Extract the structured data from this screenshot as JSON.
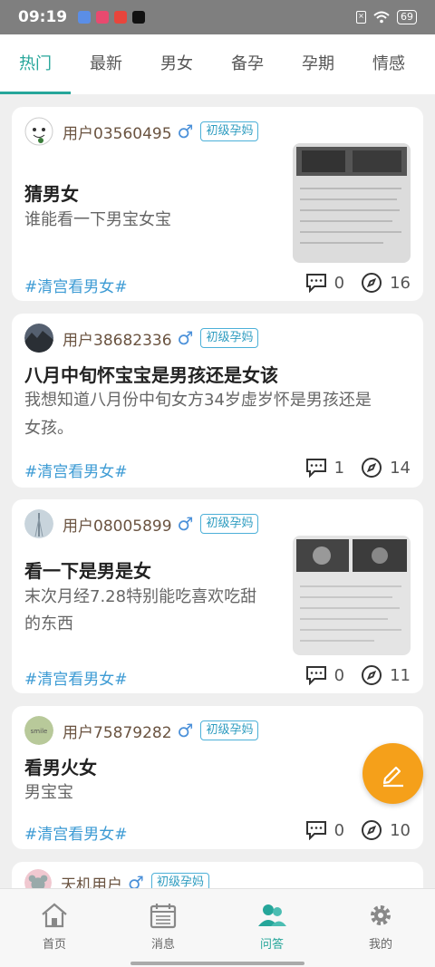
{
  "status_bar": {
    "time": "09:19",
    "battery": "69"
  },
  "tabs": [
    {
      "label": "热门",
      "active": true
    },
    {
      "label": "最新"
    },
    {
      "label": "男女"
    },
    {
      "label": "备孕"
    },
    {
      "label": "孕期"
    },
    {
      "label": "情感"
    }
  ],
  "posts": [
    {
      "user": "用户03560495",
      "gender": "♂",
      "level": "初级孕妈",
      "title": "猜男女",
      "desc": "谁能看一下男宝女宝",
      "tag": "#清宫看男女#",
      "comments": "0",
      "views": "16"
    },
    {
      "user": "用户38682336",
      "gender": "♂",
      "level": "初级孕妈",
      "title": "八月中旬怀宝宝是男孩还是女该",
      "desc_line1": "我想知道八月份中旬女方34岁虚岁怀是男孩还是",
      "desc_line2": "女孩。",
      "tag": "#清宫看男女#",
      "comments": "1",
      "views": "14"
    },
    {
      "user": "用户08005899",
      "gender": "♂",
      "level": "初级孕妈",
      "title": "看一下是男是女",
      "desc_line1": "末次月经7.28特别能吃喜欢吃甜",
      "desc_line2": "的东西",
      "tag": "#清宫看男女#",
      "comments": "0",
      "views": "11"
    },
    {
      "user": "用户75879282",
      "gender": "♂",
      "level": "初级孕妈",
      "title": "看男火女",
      "desc": "男宝宝",
      "tag": "#清宫看男女#",
      "comments": "0",
      "views": "10"
    },
    {
      "user": "天机用户",
      "gender": "♂",
      "level": "初级孕妈"
    }
  ],
  "bottom_nav": [
    {
      "label": "首页",
      "icon": "home-icon"
    },
    {
      "label": "消息",
      "icon": "calendar-icon"
    },
    {
      "label": "问答",
      "icon": "users-icon",
      "active": true
    },
    {
      "label": "我的",
      "icon": "gear-icon"
    }
  ],
  "colors": {
    "accent": "#26a69a",
    "fab": "#f5a01a",
    "tag": "#3d9bd4",
    "badge": "#2e9cc0"
  }
}
